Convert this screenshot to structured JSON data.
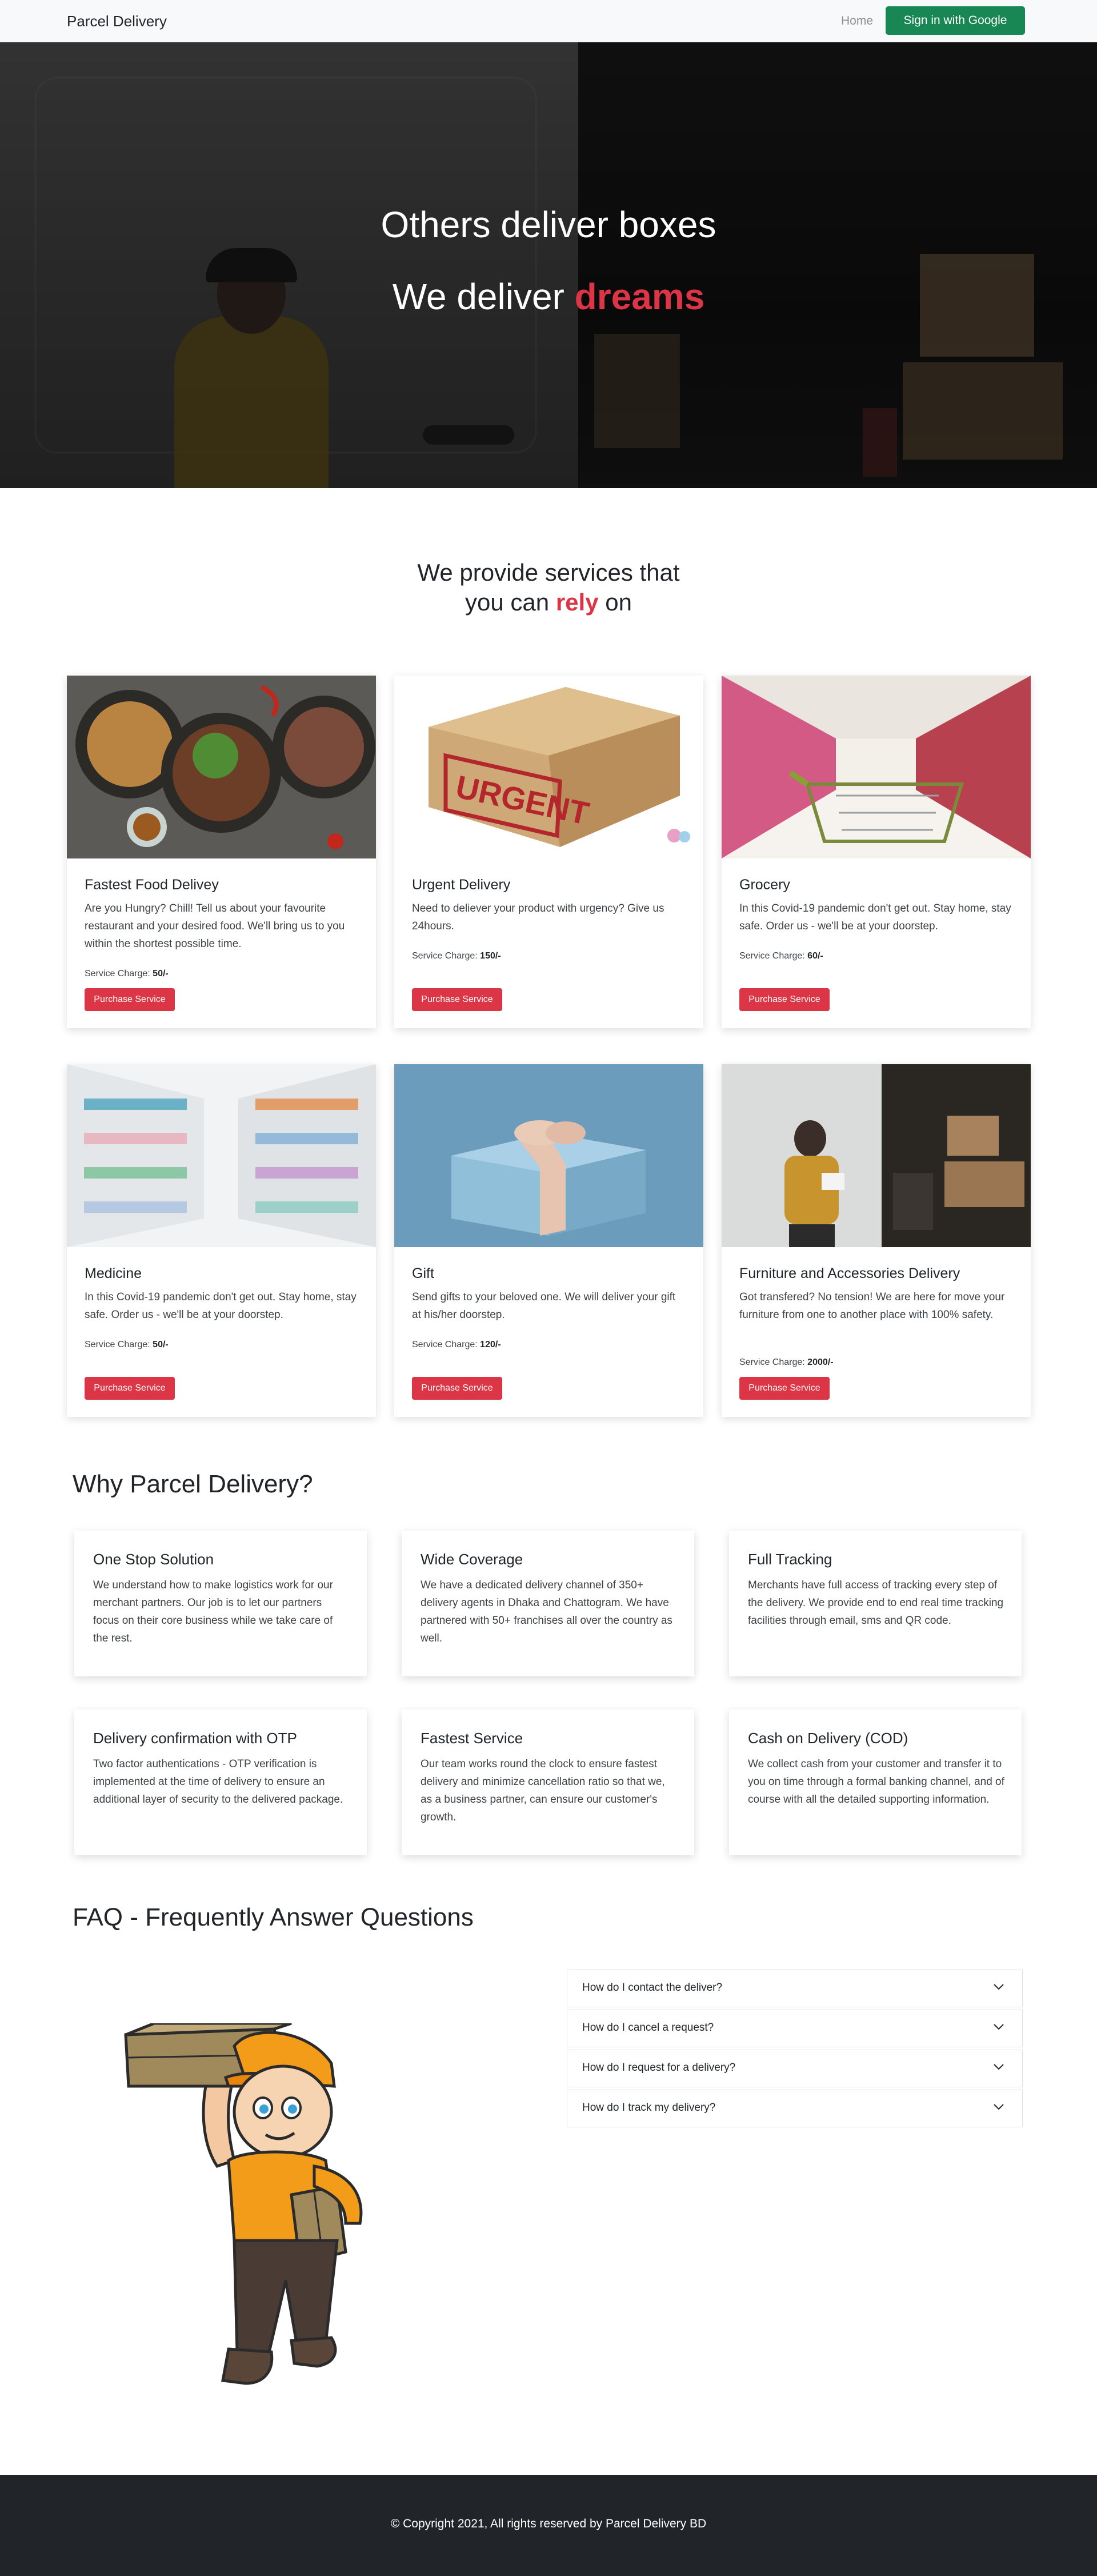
{
  "navbar": {
    "brand": "Parcel Delivery",
    "home": "Home",
    "signin": "Sign in with Google"
  },
  "hero": {
    "line1": "Others deliver boxes",
    "line2_prefix": "We deliver ",
    "line2_accent": "dreams"
  },
  "services": {
    "title_line1": "We provide services that",
    "title_line2_prefix": "you can ",
    "title_line2_accent": "rely",
    "title_line2_suffix": " on",
    "charge_label": "Service Charge: ",
    "button_label": "Purchase Service",
    "items": [
      {
        "title": "Fastest Food Delivey",
        "text": "Are you Hungry? Chill! Tell us about your favourite restaurant and your desired food. We'll bring us to you within the shortest possible time.",
        "charge": "50/-",
        "image": "food-plates-image"
      },
      {
        "title": "Urgent Delivery",
        "text": "Need to deliever your product with urgency? Give us 24hours.",
        "charge": "150/-",
        "image": "urgent-box-image"
      },
      {
        "title": "Grocery",
        "text": "In this Covid-19 pandemic don't get out. Stay home, stay safe. Order us - we'll be at your doorstep.",
        "charge": "60/-",
        "image": "shopping-cart-image"
      },
      {
        "title": "Medicine",
        "text": "In this Covid-19 pandemic don't get out. Stay home, stay safe. Order us - we'll be at your doorstep.",
        "charge": "50/-",
        "image": "pharmacy-shelves-image"
      },
      {
        "title": "Gift",
        "text": "Send gifts to your beloved one. We will deliver your gift at his/her doorstep.",
        "charge": "120/-",
        "image": "gift-box-image"
      },
      {
        "title": "Furniture and Accessories Delivery",
        "text": "Got transfered? No tension! We are here for move your furniture from one to another place with 100% safety.",
        "charge": "2000/-",
        "image": "delivery-van-image"
      }
    ]
  },
  "why": {
    "title": "Why Parcel Delivery?",
    "items": [
      {
        "title": "One Stop Solution",
        "text": "We understand how to make logistics work for our merchant partners. Our job is to let our partners focus on their core business while we take care of the rest."
      },
      {
        "title": "Wide Coverage",
        "text": "We have a dedicated delivery channel of 350+ delivery agents in Dhaka and Chattogram. We have partnered with 50+ franchises all over the country as well."
      },
      {
        "title": "Full Tracking",
        "text": "Merchants have full access of tracking every step of the delivery. We provide end to end real time tracking facilities through email, sms and QR code."
      },
      {
        "title": "Delivery confirmation with OTP",
        "text": "Two factor authentications - OTP verification is implemented at the time of delivery to ensure an additional layer of security to the delivered package."
      },
      {
        "title": "Fastest Service",
        "text": "Our team works round the clock to ensure fastest delivery and minimize cancellation ratio so that we, as a business partner, can ensure our customer's growth."
      },
      {
        "title": "Cash on Delivery (COD)",
        "text": "We collect cash from your customer and transfer it to you on time through a formal banking channel, and of course with all the detailed supporting information."
      }
    ]
  },
  "faq": {
    "title": "FAQ - Frequently Answer Questions",
    "items": [
      "How do I contact the deliver?",
      "How do I cancel a request?",
      "How do I request for a delivery?",
      "How do I track my delivery?"
    ]
  },
  "footer": {
    "copyright": "© Copyright 2021, All rights reserved by Parcel Delivery BD"
  },
  "colors": {
    "accent": "#dc3545",
    "signin": "#198754",
    "footer": "#212529"
  }
}
